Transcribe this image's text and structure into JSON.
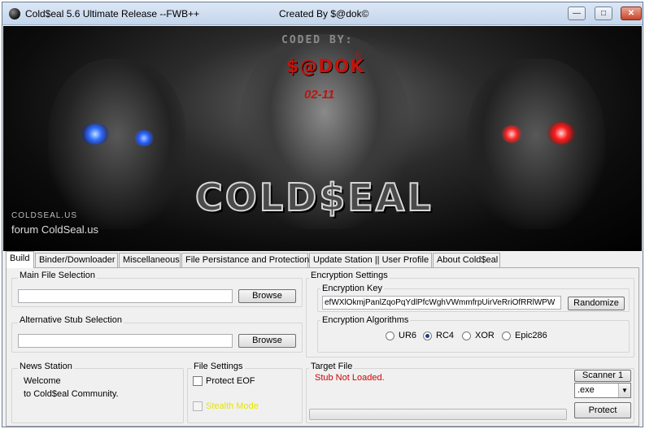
{
  "window": {
    "title": "Cold$eal 5.6 Ultimate Release --FWB++",
    "creator": "Created By $@dok©",
    "controls": {
      "minimize": "—",
      "maximize": "□",
      "close": "✕"
    }
  },
  "banner": {
    "coded_by": "CODED BY:",
    "author": "$@DOK",
    "copyright": "®",
    "date": "02-11",
    "logo": "COLD$EAL",
    "site_small": "COLDSEAL.US",
    "site_forum": "forum ColdSeal.us"
  },
  "tabs": [
    {
      "label": "Build",
      "active": true
    },
    {
      "label": "Binder/Downloader",
      "active": false
    },
    {
      "label": "Miscellaneous",
      "active": false
    },
    {
      "label": "File Persistance and Protection",
      "active": false
    },
    {
      "label": "Update Station || User Profile",
      "active": false
    },
    {
      "label": "About Cold$eal",
      "active": false
    }
  ],
  "build": {
    "main_file": {
      "label": "Main File Selection",
      "value": "",
      "browse": "Browse"
    },
    "alt_stub": {
      "label": "Alternative Stub Selection",
      "value": "",
      "browse": "Browse"
    },
    "encryption": {
      "label": "Encryption Settings",
      "key_label": "Encryption Key",
      "key_value": "efWXlOkmjPanlZqoPqYdlPfcWghVWmmfrpUirVeRriOfRRlWPW",
      "randomize": "Randomize",
      "algorithms_label": "Encryption Algorithms",
      "algorithms": [
        {
          "label": "UR6",
          "checked": false
        },
        {
          "label": "RC4",
          "checked": true
        },
        {
          "label": "XOR",
          "checked": false
        },
        {
          "label": "Epic286",
          "checked": false
        }
      ]
    },
    "news": {
      "label": "News Station",
      "line1": "Welcome",
      "line2": "to Cold$eal Community."
    },
    "file_settings": {
      "label": "File Settings",
      "protect_eof": "Protect EOF",
      "stealth_mode": "Stealth Mode"
    },
    "target": {
      "label": "Target File",
      "status": "Stub Not Loaded.",
      "progress": 0,
      "scanner": "Scanner 1",
      "extension": ".exe",
      "protect": "Protect"
    }
  }
}
